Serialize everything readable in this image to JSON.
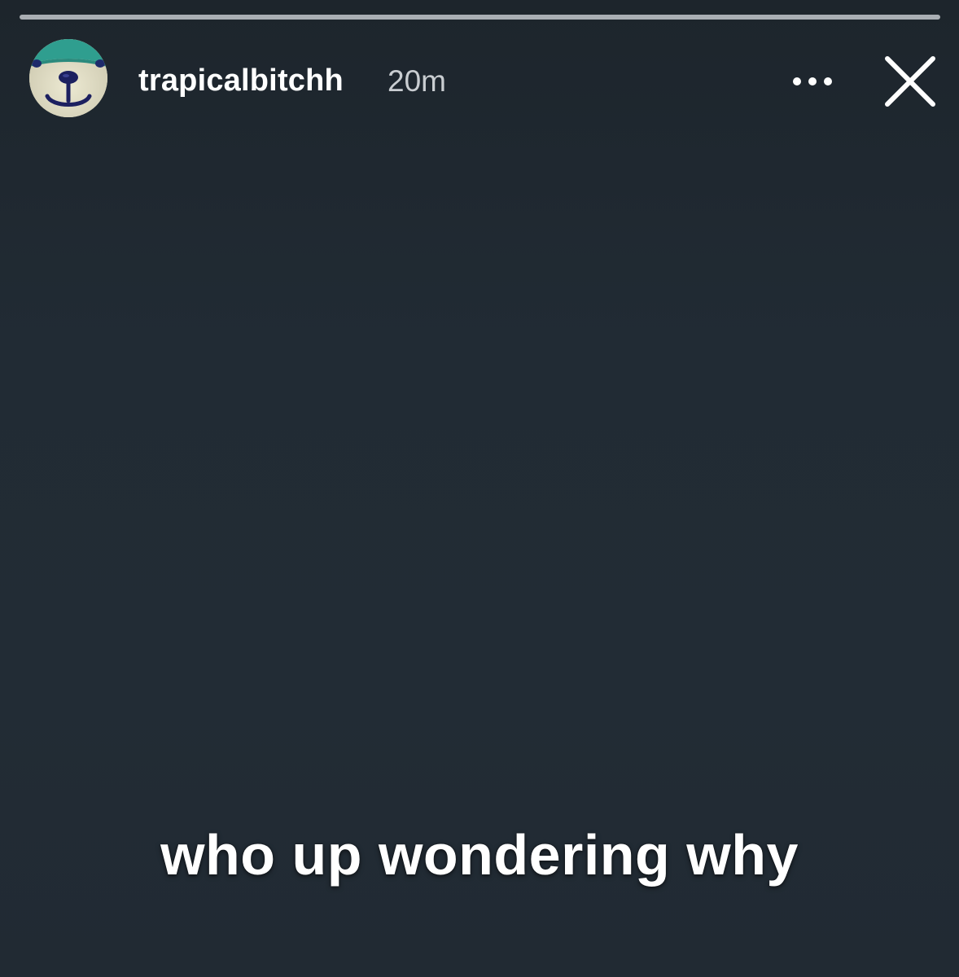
{
  "story": {
    "progress": 1.0,
    "progress_color": "#a9aeb3",
    "background_color": "#222c35"
  },
  "header": {
    "username": "trapicalbitchh",
    "timestamp": "20m",
    "avatar_icon": "otter-face-avatar",
    "more_icon": "more-horizontal-icon",
    "close_icon": "close-icon"
  },
  "caption": {
    "text": "who up wondering why"
  }
}
